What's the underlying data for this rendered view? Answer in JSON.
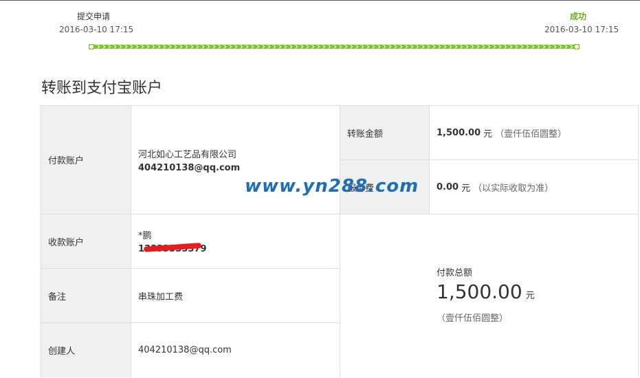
{
  "steps": [
    {
      "label": "提交申请",
      "date": "2016-03-10 17:15",
      "color": "#333333"
    },
    {
      "label": "成功",
      "date": "2016-03-10 17:15",
      "color": "#6aab1e"
    }
  ],
  "progress_color": "#7cc52a",
  "page_title": "转账到支付宝账户",
  "fields": {
    "payer": {
      "label": "付款账户",
      "name": "河北如心工艺品有限公司",
      "account": "404210138@qq.com"
    },
    "payee": {
      "label": "收款账户",
      "name": "*鹏",
      "account": "13333333379"
    },
    "note": {
      "label": "备注",
      "value": "串珠加工费"
    },
    "creator": {
      "label": "创建人",
      "value": "404210138@qq.com"
    },
    "amount": {
      "label": "转账金额",
      "value": "1,500.00",
      "unit": "元",
      "caps": "（壹仟伍佰圆整）"
    },
    "fee": {
      "label": "服务费",
      "value": "0.00",
      "unit": "元",
      "note": "（以实际收取为准）"
    },
    "total": {
      "label": "付款总额",
      "value": "1,500.00",
      "unit": "元",
      "caps": "（壹仟伍佰圆整）"
    }
  },
  "watermark": "www.yn288.com"
}
